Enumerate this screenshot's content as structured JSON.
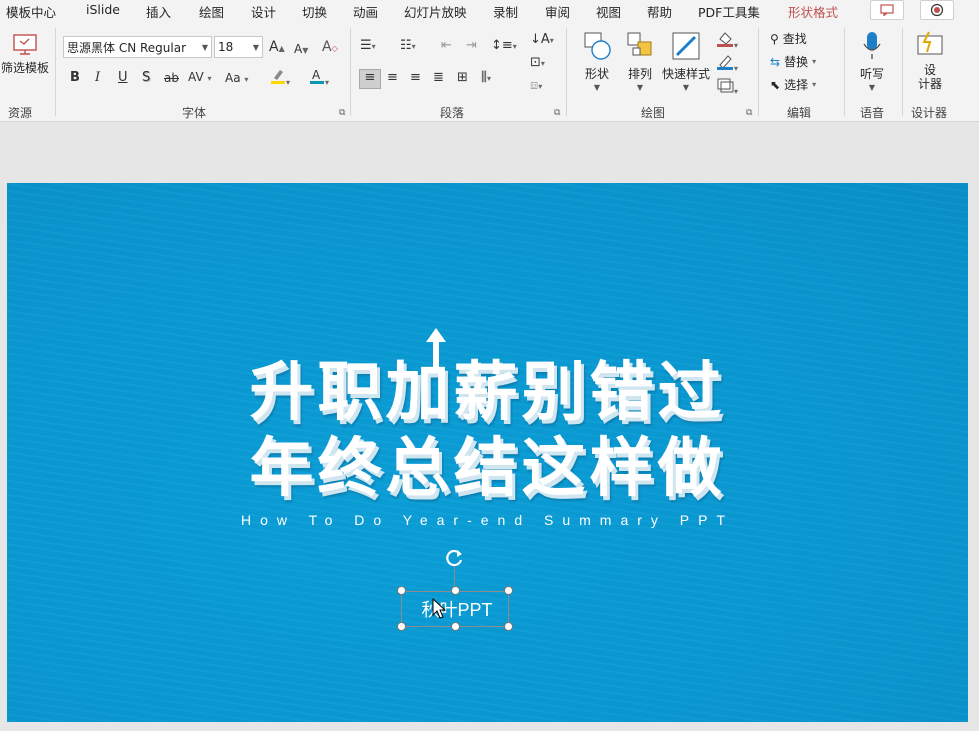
{
  "menu_tabs": [
    "模板中心",
    "iSlide",
    "插入",
    "绘图",
    "设计",
    "切换",
    "动画",
    "幻灯片放映",
    "录制",
    "审阅",
    "视图",
    "帮助",
    "PDF工具集",
    "形状格式"
  ],
  "active_tab": "形状格式",
  "ribbon": {
    "resources": {
      "button": "筛选模板",
      "group": "资源"
    },
    "font": {
      "group": "字体",
      "font_name": "思源黑体 CN Regular",
      "font_size": "18",
      "bold": "B",
      "italic": "I",
      "underline": "U",
      "shadow": "S",
      "strike": "ab",
      "spacing": "AV",
      "case": "Aa",
      "grow": "A",
      "shrink": "A",
      "clear": "A"
    },
    "paragraph": {
      "group": "段落"
    },
    "drawing": {
      "group": "绘图",
      "shapes": "形状",
      "arrange": "排列",
      "quick_styles": "快速样式"
    },
    "editing": {
      "group": "编辑",
      "find": "查找",
      "replace": "替换",
      "select": "选择"
    },
    "voice": {
      "group": "语音",
      "dictate": "听写"
    },
    "designer": {
      "group": "设计器",
      "button": "设\n计器"
    }
  },
  "slide": {
    "title_line1": "升职加薪别错过",
    "title_line2": "年终总结这样做",
    "subtitle": "How To Do Year-end Summary PPT",
    "selected_text": "秋叶PPT"
  },
  "colors": {
    "slide_bg": "#0a9bd6",
    "active_tab": "#c0504d",
    "ribbon_bg": "#f3f3f3"
  }
}
